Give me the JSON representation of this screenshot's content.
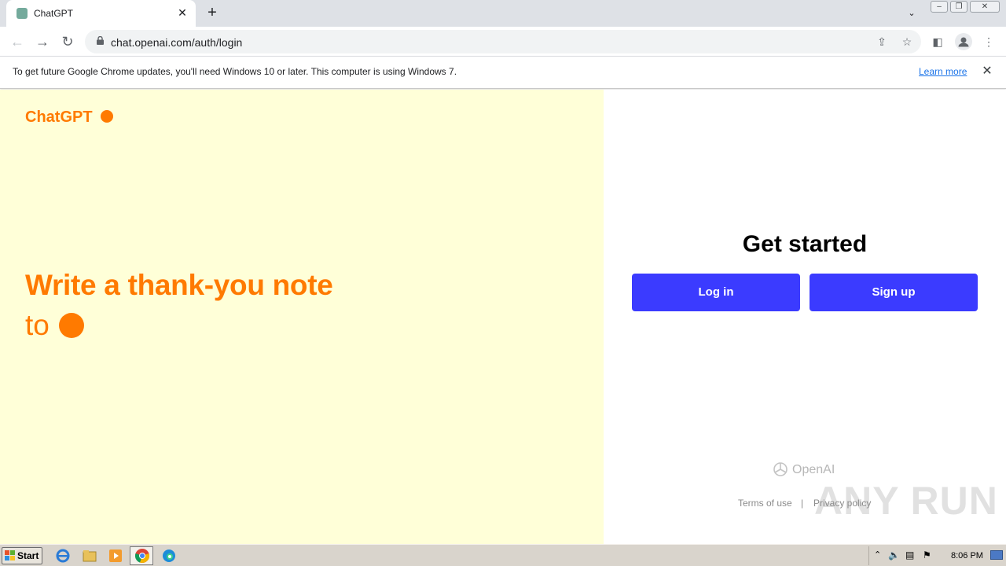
{
  "browser": {
    "tab_title": "ChatGPT",
    "tab_close": "✕",
    "new_tab": "+",
    "url": "chat.openai.com/auth/login",
    "window_controls": [
      "minimize",
      "restore",
      "close"
    ]
  },
  "infobar": {
    "message": "To get future Google Chrome updates, you'll need Windows 10 or later. This computer is using Windows 7.",
    "link": "Learn more",
    "close": "✕"
  },
  "page": {
    "brand": "ChatGPT",
    "headline_line1": "Write a thank-you note",
    "headline_line2": "to",
    "accent_color": "#ff7a00",
    "left_bg": "#ffffd8",
    "title": "Get started",
    "login_label": "Log in",
    "signup_label": "Sign up",
    "button_color": "#3b3bff",
    "footer_brand": "OpenAI",
    "terms": "Terms of use",
    "separator": "|",
    "privacy": "Privacy policy",
    "watermark": "ANY RUN"
  },
  "taskbar": {
    "start_label": "Start",
    "pinned": [
      "ie-icon",
      "explorer-icon",
      "media-player-icon",
      "chrome-icon",
      "edge-icon"
    ],
    "clock": "8:06 PM"
  }
}
